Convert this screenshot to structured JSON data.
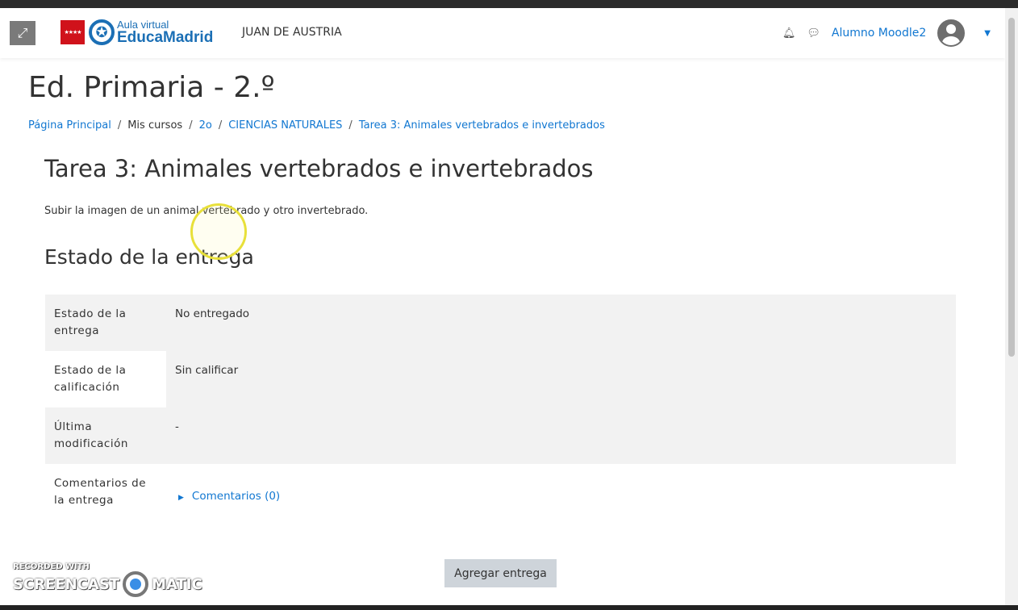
{
  "header": {
    "school": "JUAN DE AUSTRIA",
    "logo_small": "Aula virtual",
    "logo_big": "EducaMadrid",
    "user": "Alumno Moodle2"
  },
  "page": {
    "title": "Ed. Primaria - 2.º"
  },
  "breadcrumb": [
    "Página Principal",
    "Mis cursos",
    "2o",
    "CIENCIAS NATURALES",
    "Tarea 3: Animales vertebrados e invertebrados"
  ],
  "assignment": {
    "title": "Tarea 3: Animales vertebrados e invertebrados",
    "description": "Subir la imagen de un animal vertebrado y otro invertebrado.",
    "status_heading": "Estado de la entrega"
  },
  "status_table": [
    {
      "label": "Estado de la entrega",
      "value": "No entregado"
    },
    {
      "label": "Estado de la calificación",
      "value": "Sin calificar"
    },
    {
      "label": "Última modificación",
      "value": "-"
    },
    {
      "label": "Comentarios de la entrega",
      "value": "Comentarios (0)"
    }
  ],
  "actions": {
    "add_submission": "Agregar entrega"
  },
  "watermark": {
    "line1": "RECORDED WITH",
    "line2a": "SCREENCAST",
    "line2b": "MATIC"
  }
}
